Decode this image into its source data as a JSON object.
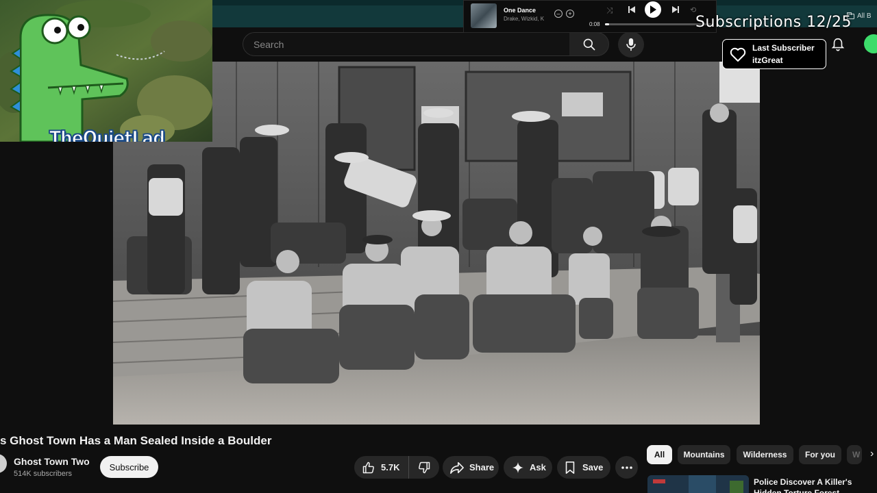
{
  "browser": {
    "bookmarks_label": "All B"
  },
  "header": {
    "search_placeholder": "Search",
    "search_icon": "search-icon",
    "mic_icon": "mic-icon",
    "bell_icon": "bell-icon"
  },
  "music_player": {
    "song_title": "One Dance",
    "song_artist": "Drake, Wizkid, K",
    "time": "0:08",
    "progress": 0.04
  },
  "overlay": {
    "subscriptions": "Subscriptions 12/25",
    "last_subscriber_label": "Last Subscriber",
    "last_subscriber_name": "itzGreat",
    "streamer_logo": "TheQuietLad"
  },
  "video": {
    "title": "s Ghost Town Has a Man Sealed Inside a Boulder",
    "channel_name": "Ghost Town Two",
    "channel_subscribers": "514K subscribers",
    "subscribe_label": "Subscribe",
    "like_count": "5.7K",
    "share_label": "Share",
    "ask_label": "Ask",
    "save_label": "Save"
  },
  "chips": [
    {
      "label": "All",
      "active": true
    },
    {
      "label": "Mountains",
      "active": false
    },
    {
      "label": "Wilderness",
      "active": false
    },
    {
      "label": "For you",
      "active": false
    },
    {
      "label": "W",
      "active": false
    }
  ],
  "recommendation": {
    "title": "Police Discover A Killer's Hidden Torture Forest"
  },
  "colors": {
    "background": "#0f0f0f",
    "browser_bar": "#12393b",
    "pill": "#272727",
    "subscribe_bg": "#f1f1f1",
    "avatar_green": "#3ddc6b",
    "logo_outline": "#1b4a86"
  }
}
